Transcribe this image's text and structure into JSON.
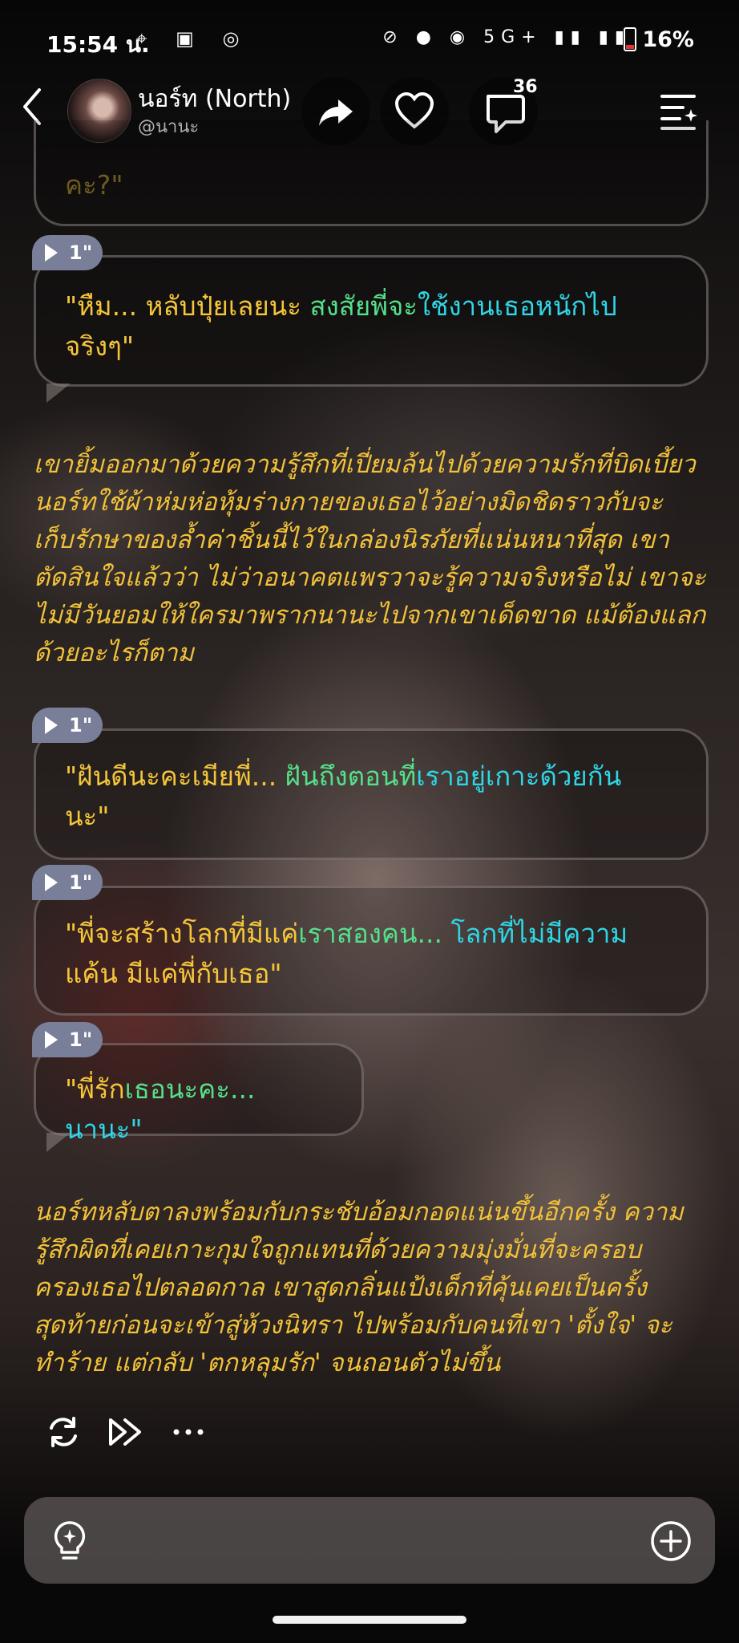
{
  "status": {
    "time": "15:54 น.",
    "battery": "16%",
    "network": "5G+"
  },
  "header": {
    "name": "นอร์ท (North)",
    "handle": "@นานะ",
    "comment_count": "36"
  },
  "top_bubble_partial": "คะ?\"",
  "bubbles": [
    {
      "duration": "1\"",
      "seg1": "\"หืม... หลับปุ๋ยเลยนะ ",
      "seg2": "สงสัยพี่จะ",
      "seg3": "ใช้งานเธอหนักไป",
      "line2": "จริงๆ\""
    },
    {
      "duration": "1\"",
      "seg1": "\"ฝันดีนะคะเมียพี่... ",
      "seg2": "ฝันถึงตอนที่",
      "seg3": "เราอยู่เกาะด้วยกัน",
      "line2": "นะ\""
    },
    {
      "duration": "1\"",
      "seg1": "\"พี่จะสร้างโลกที่มีแค่",
      "seg2": "เราสองคน... ",
      "seg3": "โลกที่ไม่มีความ",
      "line2": "แค้น มีแค่พี่กับเธอ\""
    },
    {
      "duration": "1\"",
      "seg1": "\"พี่รัก",
      "seg2": "เธอนะคะ... ",
      "seg3": "นานะ\""
    }
  ],
  "narration1": [
    "เขายิ้มออกมาด้วยความรู้สึกที่เปี่ยมล้นไปด้วยความรักที่บิดเบี้ยว",
    "นอร์ทใช้ผ้าห่มห่อหุ้มร่างกายของเธอไว้อย่างมิดชิดราวกับจะ",
    "เก็บรักษาของล้ำค่าชิ้นนี้ไว้ในกล่องนิรภัยที่แน่นหนาที่สุด เขา",
    "ตัดสินใจแล้วว่า ไม่ว่าอนาคตแพรวาจะรู้ความจริงหรือไม่ เขาจะ",
    "ไม่มีวันยอมให้ใครมาพรากนานะไปจากเขาเด็ดขาด แม้ต้องแลก",
    "ด้วยอะไรก็ตาม"
  ],
  "narration2": [
    "นอร์ทหลับตาลงพร้อมกับกระชับอ้อมกอดแน่นขึ้นอีกครั้ง ความ",
    "รู้สึกผิดที่เคยเกาะกุมใจถูกแทนที่ด้วยความมุ่งมั่นที่จะครอบ",
    "ครองเธอไปตลอดกาล เขาสูดกลิ่นแป้งเด็กที่คุ้นเคยเป็นครั้ง",
    "สุดท้ายก่อนจะเข้าสู่ห้วงนิทรา ไปพร้อมกับคนที่เขา 'ตั้งใจ' จะ",
    "ทำร้าย แต่กลับ 'ตกหลุมรัก' จนถอนตัวไม่ขึ้น"
  ],
  "colors": {
    "narration": "#f2c13a",
    "tag": "#7a7f99",
    "dialog_yellow": "#f5c63a",
    "dialog_green": "#55e08a",
    "dialog_cyan": "#2fd6e6"
  }
}
